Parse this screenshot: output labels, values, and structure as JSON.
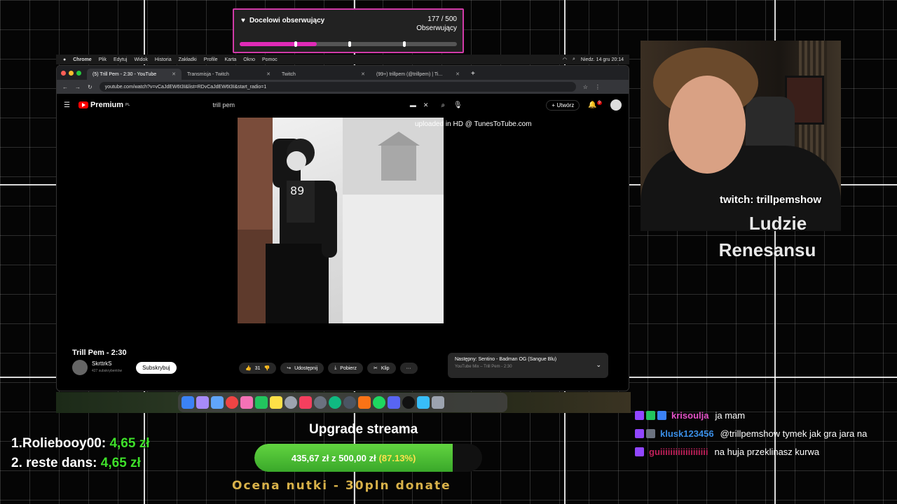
{
  "goal": {
    "title": "Docelowi obserwujący",
    "count": "177 / 500",
    "unit": "Obserwujący",
    "progress": 0.354
  },
  "menubar": {
    "app": "Chrome",
    "items": [
      "Plik",
      "Edytuj",
      "Widok",
      "Historia",
      "Zakładki",
      "Profile",
      "Karta",
      "Okno",
      "Pomoc"
    ],
    "clock": "Niedz. 14 gru 20:14"
  },
  "tabs": [
    {
      "label": "(5) Trill Pem - 2:30 - YouTube",
      "active": true
    },
    {
      "label": "Transmisja - Twitch",
      "active": false
    },
    {
      "label": "Twitch",
      "active": false
    },
    {
      "label": "(99+) trillpem (@trillpem) | Ti...",
      "active": false
    }
  ],
  "url": "youtube.com/watch?v=vCaJdEW6t3I&list=RDvCaJdEW6t3I&start_radio=1",
  "youtube": {
    "logo": "Premium",
    "logo_sup": "PL",
    "search": "trill pem",
    "create": "Utwórz",
    "notif_count": "9",
    "uploaded": "uploaded in HD @ TunesToTube.com",
    "title": "Trill Pem - 2:30",
    "channel": "SkrttrkS",
    "subs": "427 subskrybentów",
    "subscribe": "Subskrybuj",
    "likes": "31",
    "share": "Udostępnij",
    "download": "Pobierz",
    "clip": "Klip",
    "next_title": "Następny: Sentino - Badman OG (Sangue Blu)",
    "next_sub": "YouTube Mix – Trill Pem - 2:30"
  },
  "overlay": {
    "twitch": "twitch: trillpemshow",
    "album_l1": "Ludzie",
    "album_l2": "Renesansu",
    "upgrade_title": "Upgrade streama",
    "upgrade_text": "435,67 zł  z  500,00 zł",
    "upgrade_pct": "(87.13%)",
    "upgrade_progress": 0.8713,
    "ocena": "Ocena nutki - 30pln donate"
  },
  "leaders": [
    {
      "rank": "1.",
      "name": "Roliebooy00:",
      "amount": "4,65 zł"
    },
    {
      "rank": "2.",
      "name": "reste dans:",
      "amount": "4,65 zł"
    }
  ],
  "chat": [
    {
      "user": "krisoulja",
      "color": "#e452c8",
      "msg": "ja mam"
    },
    {
      "user": "klusk123456",
      "color": "#3a8ee6",
      "msg": "@trillpemshow tymek jak gra jara na"
    },
    {
      "user": "guiiiiiiiiiiiiiiiiiii",
      "color": "#c0205a",
      "msg": "na huja przeklinasz kurwa"
    }
  ]
}
